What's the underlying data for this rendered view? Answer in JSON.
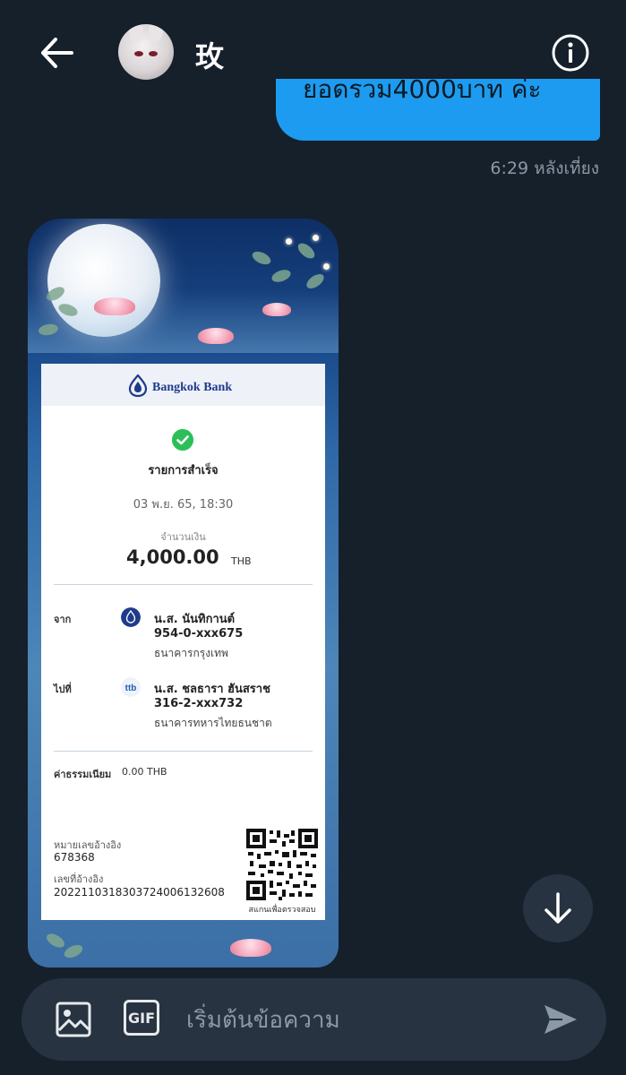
{
  "header": {
    "title": "玫",
    "back_icon": "arrow-left-icon",
    "info_icon": "info-icon"
  },
  "messages": {
    "sent_text": "ยอดรวม4000บาท ค่ะ",
    "sent_time": "6:29 หลังเที่ยง"
  },
  "receipt": {
    "bank_name": "Bangkok Bank",
    "status": "รายการสำเร็จ",
    "date": "03 พ.ย. 65, 18:30",
    "amount_label": "จำนวนเงิน",
    "amount": "4,000.00",
    "currency": "THB",
    "from_label": "จาก",
    "from_name": "น.ส. นันทิกานต์",
    "from_account": "954-0-xxx675",
    "from_bank": "ธนาคารกรุงเทพ",
    "to_label": "ไปที่",
    "to_name": "น.ส. ชลธารา ฮันสราช",
    "to_account": "316-2-xxx732",
    "to_bank": "ธนาคารทหารไทยธนชาต",
    "fee_label": "ค่าธรรมเนียม",
    "fee_value": "0.00 THB",
    "ref_label_1": "หมายเลขอ้างอิง",
    "ref_value_1": "678368",
    "ref_label_2": "เลขที่อ้างอิง",
    "ref_value_2": "2022110318303724006132608",
    "qr_caption": "สแกนเพื่อตรวจสอบ"
  },
  "composer": {
    "placeholder": "เริ่มต้นข้อความ",
    "gif_label": "GIF"
  },
  "colors": {
    "background": "#15202b",
    "bubble": "#1d9bf0",
    "surface": "#273340",
    "success": "#2bbf5a",
    "bank_blue": "#1f3b8c"
  }
}
